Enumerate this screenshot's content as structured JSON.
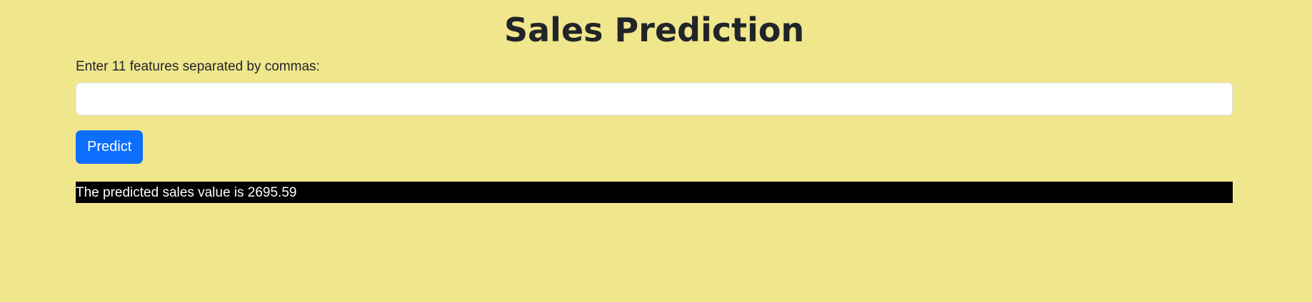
{
  "page": {
    "title": "Sales Prediction"
  },
  "form": {
    "features_label": "Enter 11 features separated by commas:",
    "features_value": "",
    "features_placeholder": "",
    "predict_label": "Predict"
  },
  "result": {
    "text": "The predicted sales value is 2695.59"
  },
  "colors": {
    "background": "#f0e68c",
    "button": "#0d6efd",
    "result_background": "#000000",
    "result_text": "#ffffff"
  }
}
